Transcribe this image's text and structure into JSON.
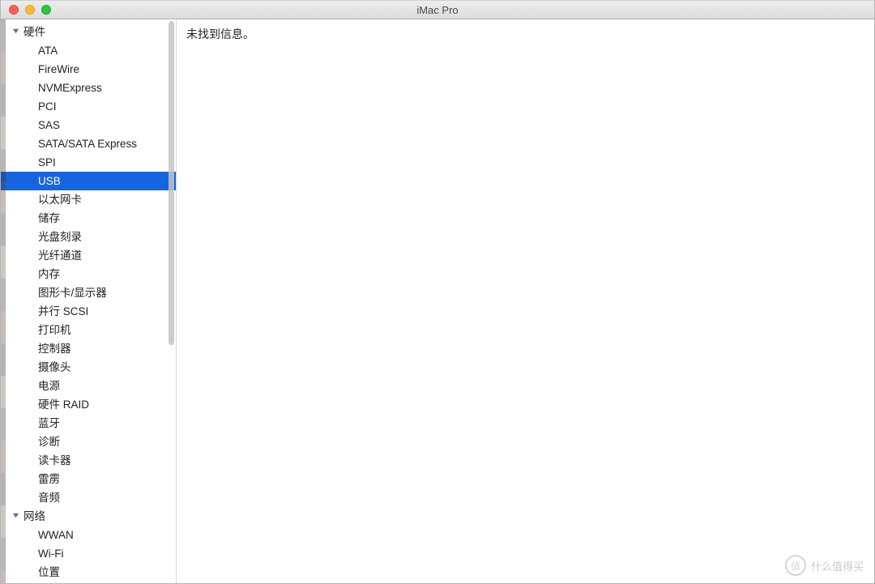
{
  "window": {
    "title": "iMac Pro"
  },
  "sidebar": {
    "groups": [
      {
        "label": "硬件",
        "expanded": true,
        "items": [
          {
            "label": "ATA",
            "selected": false
          },
          {
            "label": "FireWire",
            "selected": false
          },
          {
            "label": "NVMExpress",
            "selected": false
          },
          {
            "label": "PCI",
            "selected": false
          },
          {
            "label": "SAS",
            "selected": false
          },
          {
            "label": "SATA/SATA Express",
            "selected": false
          },
          {
            "label": "SPI",
            "selected": false
          },
          {
            "label": "USB",
            "selected": true
          },
          {
            "label": "以太网卡",
            "selected": false
          },
          {
            "label": "储存",
            "selected": false
          },
          {
            "label": "光盘刻录",
            "selected": false
          },
          {
            "label": "光纤通道",
            "selected": false
          },
          {
            "label": "内存",
            "selected": false
          },
          {
            "label": "图形卡/显示器",
            "selected": false
          },
          {
            "label": "并行 SCSI",
            "selected": false
          },
          {
            "label": "打印机",
            "selected": false
          },
          {
            "label": "控制器",
            "selected": false
          },
          {
            "label": "摄像头",
            "selected": false
          },
          {
            "label": "电源",
            "selected": false
          },
          {
            "label": "硬件 RAID",
            "selected": false
          },
          {
            "label": "蓝牙",
            "selected": false
          },
          {
            "label": "诊断",
            "selected": false
          },
          {
            "label": "读卡器",
            "selected": false
          },
          {
            "label": "雷雳",
            "selected": false
          },
          {
            "label": "音频",
            "selected": false
          }
        ]
      },
      {
        "label": "网络",
        "expanded": true,
        "items": [
          {
            "label": "WWAN",
            "selected": false
          },
          {
            "label": "Wi-Fi",
            "selected": false
          },
          {
            "label": "位置",
            "selected": false
          }
        ]
      }
    ]
  },
  "content": {
    "message": "未找到信息。"
  },
  "watermark": {
    "icon_text": "值",
    "text": "什么值得买"
  }
}
